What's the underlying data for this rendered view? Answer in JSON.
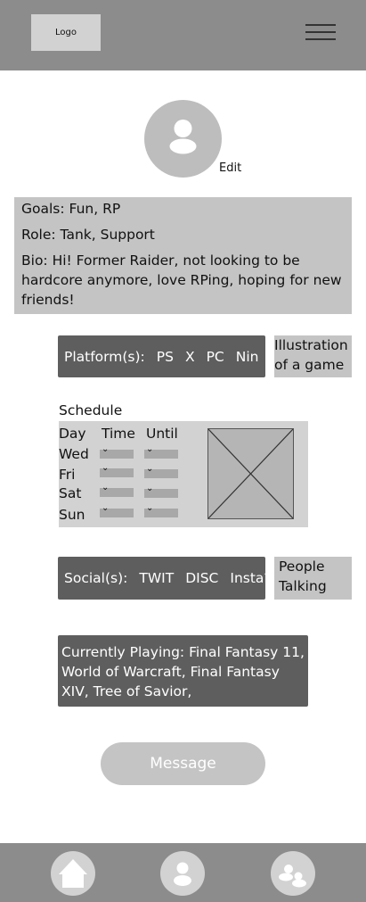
{
  "header": {
    "logo_text": "Logo",
    "menu_icon": "hamburger-menu-icon"
  },
  "profile": {
    "avatar_icon": "user-icon",
    "edit_label": "Edit"
  },
  "info": {
    "goals": "Goals: Fun, RP",
    "role": "Role: Tank, Support",
    "bio": "Bio: Hi! Former Raider, not looking to be hardcore anymore, love RPing, hoping for new friends!"
  },
  "platforms": {
    "label": "Platform(s):",
    "items": [
      "PS",
      "X",
      "PC",
      "Nin"
    ]
  },
  "illustration": {
    "text": "Illustration of a game"
  },
  "schedule": {
    "title": "Schedule",
    "headers": [
      "Day",
      "Time",
      "Until"
    ],
    "days": [
      "Wed",
      "Fri",
      "Sat",
      "Sun"
    ]
  },
  "socials": {
    "label": "Social(s):",
    "items": [
      "TWIT",
      "DISC",
      "Insta?"
    ]
  },
  "people": {
    "text": "People Talking"
  },
  "currently_playing": {
    "text": "Currently Playing: Final Fantasy 11, World of Warcraft, Final Fantasy XIV, Tree of Savior,"
  },
  "message_button": {
    "label": "Message"
  },
  "bottom_nav": {
    "icons": [
      "home-icon",
      "profile-icon",
      "chat-icon"
    ]
  }
}
